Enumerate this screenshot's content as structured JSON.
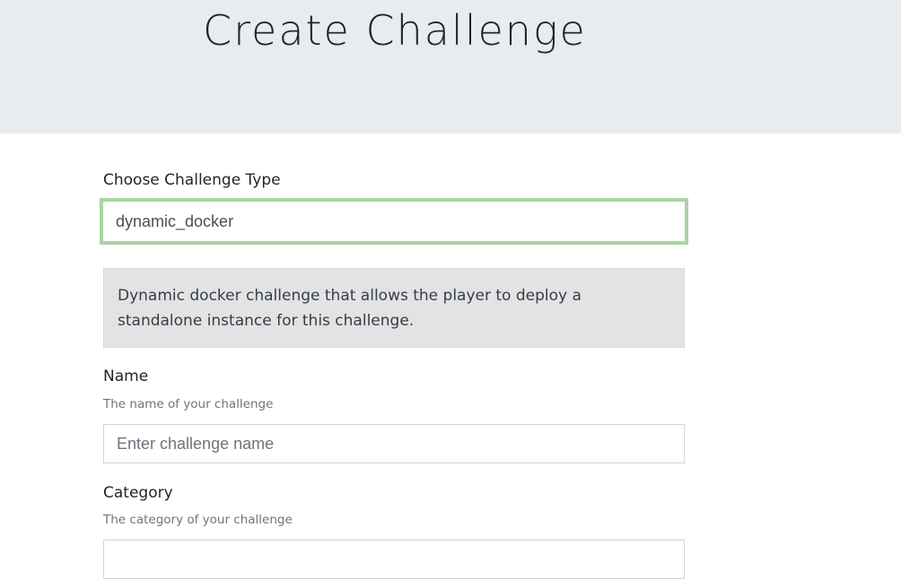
{
  "header": {
    "title": "Create Challenge"
  },
  "form": {
    "type_label": "Choose Challenge Type",
    "type_value": "dynamic_docker",
    "type_description": "Dynamic docker challenge that allows the player to deploy a standalone instance for this challenge.",
    "name_label": "Name",
    "name_help": "The name of your challenge",
    "name_placeholder": "Enter challenge name",
    "category_label": "Category",
    "category_help": "The category of your challenge"
  },
  "colors": {
    "header_bg": "#e9ecef",
    "select_focus_border": "#a8d5a2",
    "description_bg": "#e2e3e5"
  }
}
